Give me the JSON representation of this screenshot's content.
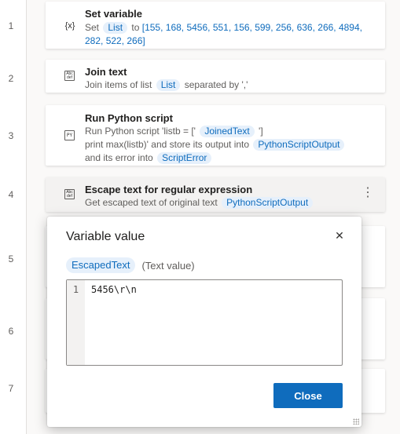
{
  "line_numbers": [
    "1",
    "2",
    "3",
    "4",
    "5",
    "6",
    "7"
  ],
  "steps": [
    {
      "title": "Set variable",
      "icon_text": "{x}",
      "desc": {
        "p1": "Set",
        "tok1": "List",
        "p2": "to",
        "value": "[155, 168, 5456, 551, 156, 599, 256, 636, 266, 4894, 282, 522, 266]"
      }
    },
    {
      "title": "Join text",
      "icon_text": [
        "Abc",
        "def"
      ],
      "desc": {
        "p1": "Join items of list",
        "tok1": "List",
        "p2": "separated by ','"
      }
    },
    {
      "title": "Run Python script",
      "icon_text": "PY",
      "desc": {
        "p1": "Run Python script 'listb = ['",
        "tok1": "JoinedText",
        "p2": "']",
        "p3": "print max(listb)' and store its output into",
        "tok2": "PythonScriptOutput",
        "p4": "and its error into",
        "tok3": "ScriptError"
      }
    },
    {
      "title": "Escape text for regular expression",
      "icon_text": [
        "Abc",
        "def"
      ],
      "desc": {
        "p1": "Get escaped text of original text",
        "tok1": "PythonScriptOutput"
      },
      "more": "⋮"
    }
  ],
  "dialog": {
    "title": "Variable value",
    "close_icon": "✕",
    "variable_name": "EscapedText",
    "variable_type": "(Text value)",
    "editor": {
      "line_number": "1",
      "value": "5456\\r\\n"
    },
    "close_label": "Close"
  },
  "colors": {
    "accent": "#0f6cbd",
    "token_bg": "#e6f0fb"
  }
}
